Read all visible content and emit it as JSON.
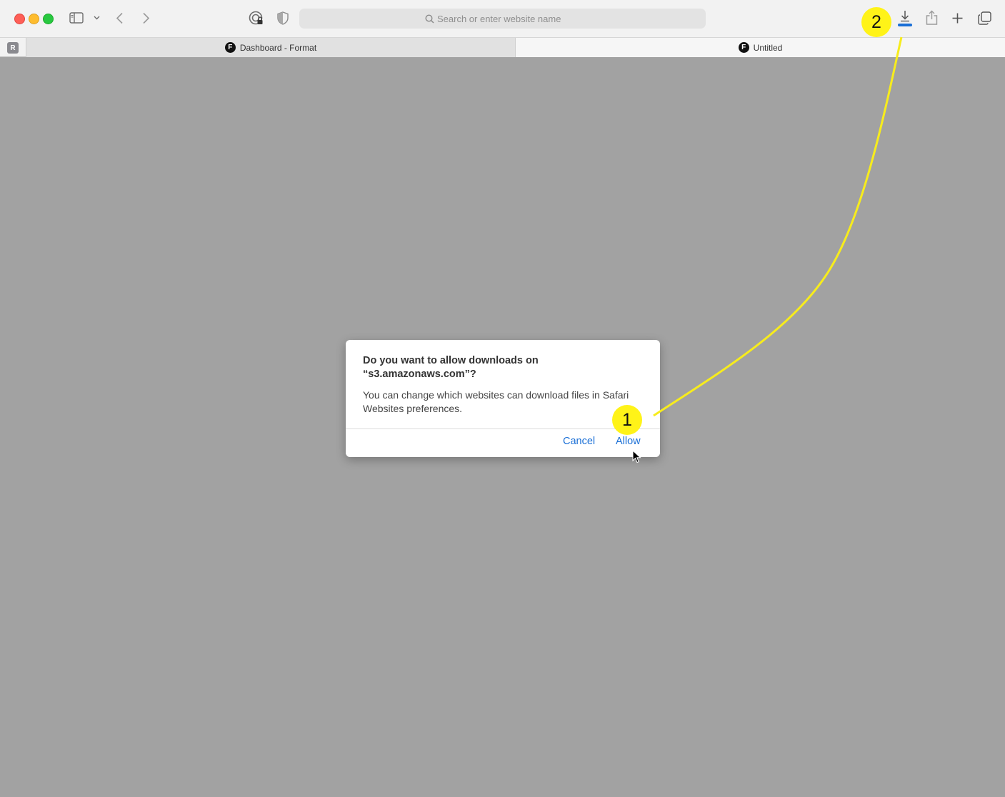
{
  "browser": {
    "address_bar": {
      "placeholder": "Search or enter website name"
    },
    "pinned_tab": {
      "letter": "R"
    },
    "tabs": [
      {
        "label": "Dashboard - Format",
        "favicon_letter": "F"
      },
      {
        "label": "Untitled",
        "favicon_letter": "F"
      }
    ],
    "toolbar_icons": [
      "sidebar-icon",
      "chevron-down-icon",
      "back-icon",
      "forward-icon",
      "password-manager-icon",
      "privacy-shield-icon",
      "download-icon",
      "share-icon",
      "plus-icon",
      "tabs-overview-icon"
    ],
    "accent_color": "#1a6fd6"
  },
  "dialog": {
    "title_line1": "Do you want to allow downloads on",
    "title_line2": "“s3.amazonaws.com”?",
    "message": "You can change which websites can download files in Safari Websites preferences.",
    "cancel_label": "Cancel",
    "allow_label": "Allow"
  },
  "annotations": {
    "step1": "1",
    "step2": "2",
    "color": "#fff318"
  }
}
